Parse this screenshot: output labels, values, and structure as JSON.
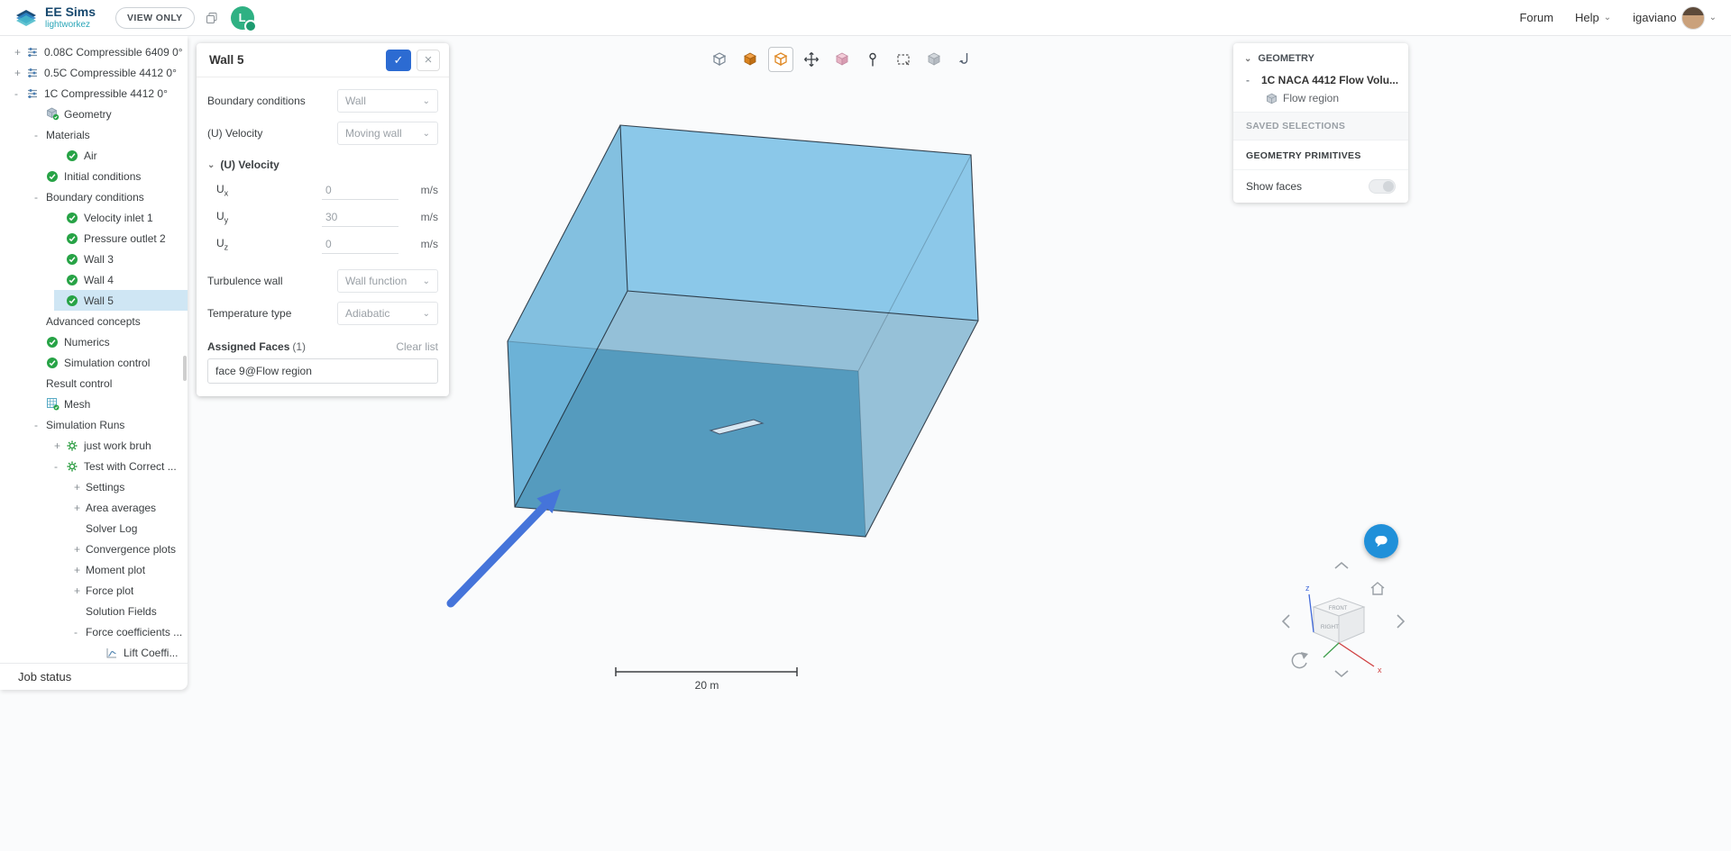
{
  "topbar": {
    "brand": {
      "name": "EE Sims",
      "subtitle": "lightworkez"
    },
    "view_only": "VIEW ONLY",
    "avatar_letter": "L",
    "links": {
      "forum": "Forum",
      "help": "Help",
      "username": "igaviano"
    }
  },
  "icons": {
    "chevron_down": "⌄",
    "check": "✓",
    "close": "×"
  },
  "sidebar": {
    "items": [
      {
        "label": "0.08C Compressible 6409 0°",
        "level": 0,
        "expander": "+",
        "icon": "simulation"
      },
      {
        "label": "0.5C Compressible 4412 0°",
        "level": 0,
        "expander": "+",
        "icon": "simulation"
      },
      {
        "label": "1C Compressible 4412 0°",
        "level": 0,
        "expander": "-",
        "icon": "simulation"
      },
      {
        "label": "Geometry",
        "level": 1,
        "expander": "",
        "icon": "geometry"
      },
      {
        "label": "Materials",
        "level": 1,
        "expander": "-",
        "icon": ""
      },
      {
        "label": "Air",
        "level": 2,
        "expander": "",
        "icon": "check"
      },
      {
        "label": "Initial conditions",
        "level": 1,
        "expander": "",
        "icon": "check"
      },
      {
        "label": "Boundary conditions",
        "level": 1,
        "expander": "-",
        "icon": ""
      },
      {
        "label": "Velocity inlet 1",
        "level": 2,
        "expander": "",
        "icon": "check"
      },
      {
        "label": "Pressure outlet 2",
        "level": 2,
        "expander": "",
        "icon": "check"
      },
      {
        "label": "Wall 3",
        "level": 2,
        "expander": "",
        "icon": "check"
      },
      {
        "label": "Wall 4",
        "level": 2,
        "expander": "",
        "icon": "check"
      },
      {
        "label": "Wall 5",
        "level": 2,
        "expander": "",
        "icon": "check",
        "selected": true
      },
      {
        "label": "Advanced concepts",
        "level": 1,
        "expander": "",
        "icon": ""
      },
      {
        "label": "Numerics",
        "level": 1,
        "expander": "",
        "icon": "check"
      },
      {
        "label": "Simulation control",
        "level": 1,
        "expander": "",
        "icon": "check"
      },
      {
        "label": "Result control",
        "level": 1,
        "expander": "",
        "icon": ""
      },
      {
        "label": "Mesh",
        "level": 1,
        "expander": "",
        "icon": "mesh"
      },
      {
        "label": "Simulation Runs",
        "level": 1,
        "expander": "-",
        "icon": ""
      },
      {
        "label": "just work bruh",
        "level": 2,
        "expander": "+",
        "icon": "gear"
      },
      {
        "label": "Test with Correct ...",
        "level": 2,
        "expander": "-",
        "icon": "gear"
      },
      {
        "label": "Settings",
        "level": 3,
        "expander": "+",
        "icon": ""
      },
      {
        "label": "Area averages",
        "level": 3,
        "expander": "+",
        "icon": ""
      },
      {
        "label": "Solver Log",
        "level": 3,
        "expander": "",
        "icon": ""
      },
      {
        "label": "Convergence plots",
        "level": 3,
        "expander": "+",
        "icon": ""
      },
      {
        "label": "Moment plot",
        "level": 3,
        "expander": "+",
        "icon": ""
      },
      {
        "label": "Force plot",
        "level": 3,
        "expander": "+",
        "icon": ""
      },
      {
        "label": "Solution Fields",
        "level": 3,
        "expander": "",
        "icon": ""
      },
      {
        "label": "Force coefficients ...",
        "level": 3,
        "expander": "-",
        "icon": ""
      },
      {
        "label": "Lift Coeffi...",
        "level": 4,
        "expander": "",
        "icon": "chart"
      }
    ],
    "job_status": "Job status"
  },
  "panel": {
    "title": "Wall 5",
    "fields_top": [
      {
        "label": "Boundary conditions",
        "value": "Wall"
      },
      {
        "label": "(U) Velocity",
        "value": "Moving wall"
      }
    ],
    "velocity": {
      "header": "(U) Velocity",
      "fields": [
        {
          "base": "U",
          "sub": "x",
          "value": "0",
          "unit": "m/s"
        },
        {
          "base": "U",
          "sub": "y",
          "value": "30",
          "unit": "m/s"
        },
        {
          "base": "U",
          "sub": "z",
          "value": "0",
          "unit": "m/s"
        }
      ]
    },
    "fields_bottom": [
      {
        "label": "Turbulence wall",
        "value": "Wall function"
      },
      {
        "label": "Temperature type",
        "value": "Adiabatic"
      }
    ],
    "assigned": {
      "label": "Assigned Faces",
      "count": "(1)",
      "clear_label": "Clear list",
      "entries": [
        "face 9@Flow region"
      ]
    }
  },
  "toolbar": {
    "buttons": [
      {
        "name": "perspective-cube",
        "icon": "cube-wire-gray"
      },
      {
        "name": "solid-view",
        "icon": "cube-solid-orange"
      },
      {
        "name": "transparent-view",
        "icon": "cube-wire-orange",
        "active": true
      },
      {
        "name": "move-entity",
        "icon": "move-arrows"
      },
      {
        "name": "highlight-view",
        "icon": "cube-pink"
      },
      {
        "name": "probe-point",
        "icon": "pin"
      },
      {
        "name": "box-select",
        "icon": "box-select"
      },
      {
        "name": "hidden-geometry",
        "icon": "cube-gray"
      },
      {
        "name": "measure-hook",
        "icon": "hook"
      }
    ]
  },
  "right_panel": {
    "geometry_header": "GEOMETRY",
    "tree_expander": "-",
    "tree_item": "1C NACA 4412 Flow Volu...",
    "sub_item": "Flow region",
    "saved_selections": "SAVED SELECTIONS",
    "geometry_primitives": "GEOMETRY PRIMITIVES",
    "show_faces": "Show faces"
  },
  "viewport": {
    "scale_label": "20 m",
    "navcube": {
      "top_label": "FRONT",
      "front_label": "RIGHT",
      "axis_z": "z",
      "axis_x": "x"
    }
  }
}
